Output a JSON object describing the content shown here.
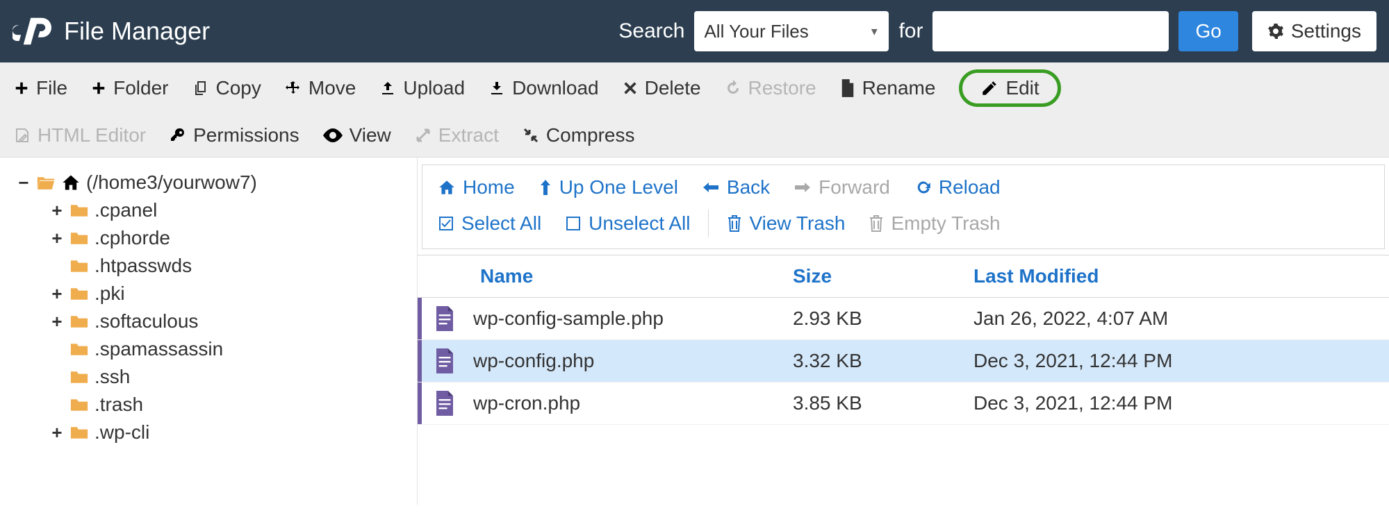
{
  "header": {
    "app_title": "File Manager",
    "search_label": "Search",
    "search_select": "All Your Files",
    "for_label": "for",
    "go_label": "Go",
    "settings_label": "Settings"
  },
  "toolbar": {
    "file": "File",
    "folder": "Folder",
    "copy": "Copy",
    "move": "Move",
    "upload": "Upload",
    "download": "Download",
    "delete": "Delete",
    "restore": "Restore",
    "rename": "Rename",
    "edit": "Edit",
    "html_editor": "HTML Editor",
    "permissions": "Permissions",
    "view": "View",
    "extract": "Extract",
    "compress": "Compress"
  },
  "tree": {
    "root_label": "(/home3/yourwow7)",
    "items": [
      {
        "exp": "+",
        "label": ".cpanel"
      },
      {
        "exp": "+",
        "label": ".cphorde"
      },
      {
        "exp": "",
        "label": ".htpasswds"
      },
      {
        "exp": "+",
        "label": ".pki"
      },
      {
        "exp": "+",
        "label": ".softaculous"
      },
      {
        "exp": "",
        "label": ".spamassassin"
      },
      {
        "exp": "",
        "label": ".ssh"
      },
      {
        "exp": "",
        "label": ".trash"
      },
      {
        "exp": "+",
        "label": ".wp-cli"
      }
    ]
  },
  "nav": {
    "home": "Home",
    "up": "Up One Level",
    "back": "Back",
    "forward": "Forward",
    "reload": "Reload",
    "select_all": "Select All",
    "unselect_all": "Unselect All",
    "view_trash": "View Trash",
    "empty_trash": "Empty Trash"
  },
  "table": {
    "head": {
      "name": "Name",
      "size": "Size",
      "modified": "Last Modified"
    },
    "rows": [
      {
        "name": "wp-config-sample.php",
        "size": "2.93 KB",
        "modified": "Jan 26, 2022, 4:07 AM",
        "selected": false
      },
      {
        "name": "wp-config.php",
        "size": "3.32 KB",
        "modified": "Dec 3, 2021, 12:44 PM",
        "selected": true
      },
      {
        "name": "wp-cron.php",
        "size": "3.85 KB",
        "modified": "Dec 3, 2021, 12:44 PM",
        "selected": false
      }
    ]
  }
}
